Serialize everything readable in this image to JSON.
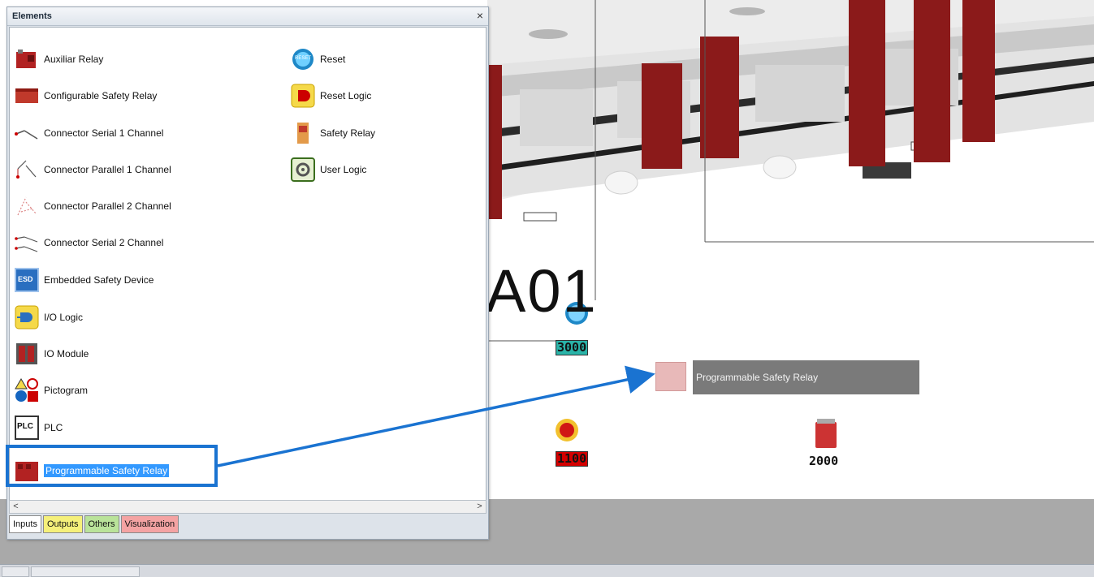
{
  "panel": {
    "title": "Elements",
    "close": "×",
    "left_items": [
      {
        "label": "Auxiliar Relay",
        "icon": "auxiliar-relay-icon"
      },
      {
        "label": "Configurable Safety Relay",
        "icon": "configurable-safety-relay-icon"
      },
      {
        "label": "Connector  Serial 1 Channel",
        "icon": "connector-serial-1-channel-icon"
      },
      {
        "label": "Connector Parallel 1 Channel",
        "icon": "connector-parallel-1-channel-icon"
      },
      {
        "label": "Connector Parallel 2 Channel",
        "icon": "connector-parallel-2-channel-icon"
      },
      {
        "label": "Connector Serial 2 Channel",
        "icon": "connector-serial-2-channel-icon"
      },
      {
        "label": "Embedded Safety Device",
        "icon": "embedded-safety-device-icon"
      },
      {
        "label": "I/O Logic",
        "icon": "io-logic-icon"
      },
      {
        "label": "IO Module",
        "icon": "io-module-icon"
      },
      {
        "label": "Pictogram",
        "icon": "pictogram-icon"
      },
      {
        "label": "PLC",
        "icon": "plc-icon"
      },
      {
        "label": "Programmable Safety Relay",
        "icon": "programmable-safety-relay-icon",
        "selected": true
      }
    ],
    "right_items": [
      {
        "label": "Reset",
        "icon": "reset-icon"
      },
      {
        "label": "Reset Logic",
        "icon": "reset-logic-icon"
      },
      {
        "label": "Safety Relay",
        "icon": "safety-relay-icon"
      },
      {
        "label": "User Logic",
        "icon": "user-logic-icon"
      }
    ],
    "icon_text": {
      "esd": "ESD",
      "plc": "PLC",
      "reset": "RESET"
    },
    "scroll": {
      "left": "<",
      "right": ">"
    },
    "tabs": [
      {
        "label": "Inputs",
        "color": "#ffffff"
      },
      {
        "label": "Outputs",
        "color": "#f5f07a"
      },
      {
        "label": "Others",
        "color": "#b9e39a"
      },
      {
        "label": "Visualization",
        "color": "#f4a3a3"
      }
    ]
  },
  "canvas": {
    "big_label": "A01",
    "drop_preview_label": "Programmable Safety Relay",
    "tags": {
      "reset_tag": "3000",
      "estop_tag": "1100",
      "relay_tag": "2000"
    },
    "colors": {
      "relay_red": "#8b1a1a",
      "tag_teal": "#20b2aa",
      "tag_red": "#d40000",
      "highlight_blue": "#1a73d1"
    }
  }
}
